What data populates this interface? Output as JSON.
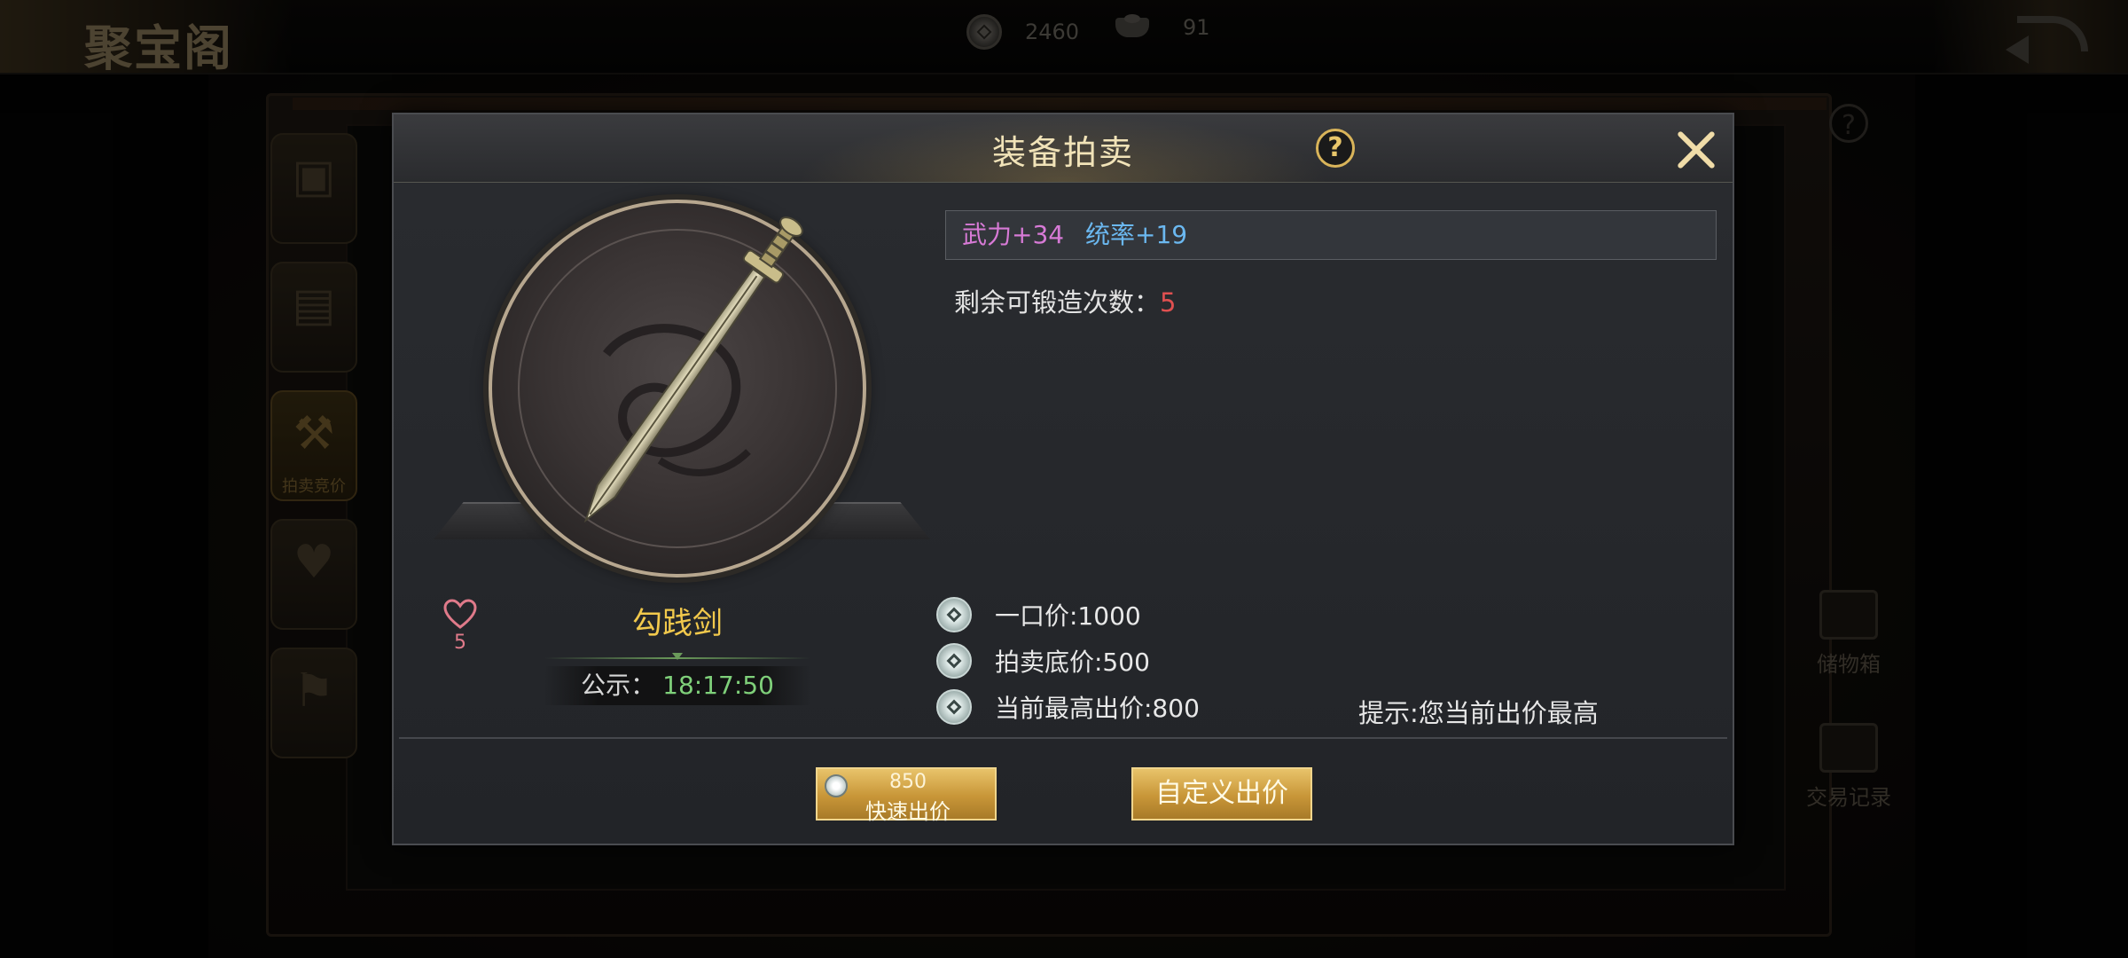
{
  "topbar": {
    "title": "聚宝阁",
    "coins": "2460",
    "ingots": "91"
  },
  "right_buttons": {
    "storage": "储物箱",
    "records": "交易记录"
  },
  "side_tabs": {
    "active_label": "拍卖竞价"
  },
  "modal": {
    "title": "装备拍卖",
    "item": {
      "name": "勾践剑",
      "likes": "5",
      "publicity_label": "公示：",
      "publicity_time": "18:17:50"
    },
    "stats": {
      "wuli": "武力+34",
      "tongshuai": "统率+19"
    },
    "forge": {
      "label": "剩余可锻造次数：",
      "count": "5"
    },
    "prices": {
      "buyout": "一口价:1000",
      "base": "拍卖底价:500",
      "current_highest": "当前最高出价:800"
    },
    "hint": "提示:您当前出价最高",
    "buttons": {
      "quick_amount": "850",
      "quick_label": "快速出价",
      "custom_label": "自定义出价"
    }
  },
  "colors": {
    "gold_text": "#f2c94c",
    "stat_wuli": "#d77ad6",
    "stat_tongshuai": "#6bb8f0",
    "forge_count": "#e05050",
    "timer": "#7fd07a"
  },
  "icons": [
    "coin-icon",
    "ingot-icon",
    "back-icon",
    "help-icon",
    "close-icon",
    "heart-icon",
    "sword-icon"
  ]
}
